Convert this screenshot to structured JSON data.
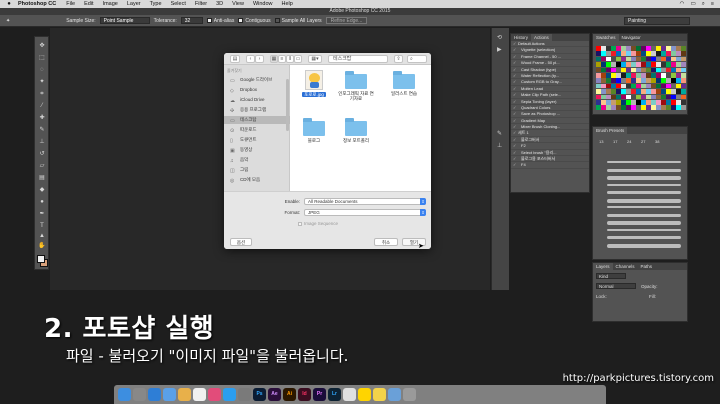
{
  "menubar": {
    "apple": "",
    "app_name": "Photoshop CC",
    "items": [
      "File",
      "Edit",
      "Image",
      "Layer",
      "Type",
      "Select",
      "Filter",
      "3D",
      "View",
      "Window",
      "Help"
    ],
    "status_icons": [
      "wifi-icon",
      "battery-icon",
      "search-icon",
      "menu-icon"
    ]
  },
  "window": {
    "title": "Adobe Photoshop CC 2015"
  },
  "options": {
    "sample_size_label": "Sample Size:",
    "sample_size_value": "Point Sample",
    "tolerance_label": "Tolerance:",
    "tolerance_value": "32",
    "anti_alias": "Anti-alias",
    "contiguous": "Contiguous",
    "sample_all": "Sample All Layers",
    "refine_edge": "Refine Edge...",
    "workspace": "Painting"
  },
  "dialog": {
    "location": "테스크탑",
    "sidebar": {
      "favorites_header": "즐겨찾기",
      "items": [
        {
          "label": "Google 드라이브",
          "icon": "folder-icon"
        },
        {
          "label": "Dropbox",
          "icon": "dropbox-icon"
        },
        {
          "label": "iCloud Drive",
          "icon": "cloud-icon"
        },
        {
          "label": "응용 프로그램",
          "icon": "apps-icon"
        },
        {
          "label": "테스크탑",
          "icon": "desktop-icon",
          "selected": true
        },
        {
          "label": "따운로드",
          "icon": "download-icon"
        },
        {
          "label": "도큐먼트",
          "icon": "document-icon"
        },
        {
          "label": "동영상",
          "icon": "movie-icon"
        },
        {
          "label": "음악",
          "icon": "music-icon"
        },
        {
          "label": "그림",
          "icon": "picture-icon"
        },
        {
          "label": "CD에 모음",
          "icon": "disc-icon"
        }
      ]
    },
    "files": [
      {
        "name": "포로로.jpg",
        "type": "image",
        "selected": true
      },
      {
        "name": "인포그래픽 자료 연 기자료",
        "type": "folder"
      },
      {
        "name": "일러스트 연습",
        "type": "folder"
      },
      {
        "name": "블로그",
        "type": "folder"
      },
      {
        "name": "정보 포트폴리",
        "type": "folder"
      }
    ],
    "enable_label": "Enable:",
    "enable_value": "All Readable Documents",
    "format_label": "Format:",
    "format_value": "JPEG",
    "image_sequence": "Image Sequence",
    "options_button": "옵션",
    "cancel_button": "취소",
    "open_button": "열기"
  },
  "actions_panel": {
    "tabs": [
      "History",
      "Actions"
    ],
    "items": [
      "Default Actions",
      "Vignette (selection)",
      "Frame Channel - 50 ...",
      "Wood Frame - 50 pl...",
      "Cast Shadow (type)",
      "Water Reflection (ty...",
      "Custom RGB to Gray...",
      "Molten Lead",
      "Make Clip Path (sele...",
      "Sepia Toning (layer)",
      "Quadrant Colors",
      "Save as Photoshop ...",
      "Gradient Map",
      "Mixer Brush Cloning...",
      "세트 1",
      "블로그버서",
      "F2",
      "Select brush \"용리...",
      "블로그용 포스터버서",
      "F4"
    ]
  },
  "swatches_panel": {
    "tabs": [
      "Swatches",
      "Navigator"
    ]
  },
  "brush_panel": {
    "title": "Brush Presets",
    "sizes": [
      "13",
      "17",
      "24",
      "27",
      "38"
    ]
  },
  "layers_panel": {
    "tabs": [
      "Layers",
      "Channels",
      "Paths"
    ],
    "kind": "Kind",
    "blend": "Normal",
    "opacity_label": "Opacity:",
    "lock_label": "Lock:",
    "fill_label": "Fill:"
  },
  "caption": {
    "title": "2. 포토샵 실행",
    "subtitle": "파일 - 불러오기 \"이미지 파일\"을 불러옵니다."
  },
  "watermark": "http://parkpictures.tistory.com",
  "dock": {
    "apps": [
      "Finder",
      "Launchpad",
      "Safari",
      "Mail",
      "Photos",
      "Calendar",
      "iTunes",
      "App Store",
      "Settings",
      "Ps",
      "Ae",
      "Ai",
      "Id",
      "Pr",
      "Lr",
      "Chrome",
      "KakaoTalk",
      "Notes",
      "Preview",
      "Trash"
    ]
  }
}
